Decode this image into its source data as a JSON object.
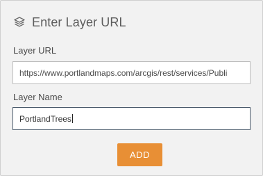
{
  "dialog": {
    "title": "Enter Layer URL",
    "title_icon": "layers-icon"
  },
  "fields": {
    "layer_url": {
      "label": "Layer URL",
      "value": "https://www.portlandmaps.com/arcgis/rest/services/Publi"
    },
    "layer_name": {
      "label": "Layer Name",
      "value": "PortlandTrees"
    }
  },
  "actions": {
    "add_label": "ADD",
    "add_color": "#e88f35"
  }
}
